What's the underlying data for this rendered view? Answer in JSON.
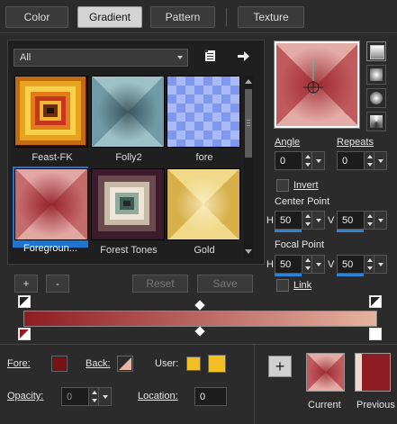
{
  "tabs": [
    {
      "label": "Color",
      "active": false
    },
    {
      "label": "Gradient",
      "active": true
    },
    {
      "label": "Pattern",
      "active": false
    },
    {
      "label": "Texture",
      "active": false
    }
  ],
  "library": {
    "filter_value": "All",
    "items": [
      {
        "label": "Feast-FK",
        "selected": false
      },
      {
        "label": "Folly2",
        "selected": false
      },
      {
        "label": "fore",
        "selected": false
      },
      {
        "label": "Foregroun...",
        "selected": true
      },
      {
        "label": "Forest Tones",
        "selected": false
      },
      {
        "label": "Gold",
        "selected": false
      }
    ]
  },
  "buttons": {
    "add": "+",
    "remove": "-",
    "reset": "Reset",
    "save": "Save",
    "add_swatch": "+"
  },
  "settings": {
    "angle_label": "Angle",
    "angle_value": "0",
    "repeats_label": "Repeats",
    "repeats_value": "0",
    "invert_label": "Invert",
    "center_point_label": "Center Point",
    "center_h_label": "H",
    "center_h_value": "50",
    "center_v_label": "V",
    "center_v_value": "50",
    "focal_point_label": "Focal Point",
    "focal_h_label": "H",
    "focal_h_value": "50",
    "focal_v_label": "V",
    "focal_v_value": "50",
    "link_label": "Link"
  },
  "bottom": {
    "fore_label": "Fore:",
    "back_label": "Back:",
    "user_label": "User:",
    "opacity_label": "Opacity:",
    "opacity_value": "0",
    "location_label": "Location:",
    "location_value": "0",
    "current_label": "Current",
    "previous_label": "Previous"
  },
  "colors": {
    "accent_blue": "#1e74d0",
    "gradient_start": "#8e1d23",
    "gradient_end": "#e6b2a0",
    "user_swatch": "#f2c024",
    "fore_swatch": "#7d1015"
  }
}
